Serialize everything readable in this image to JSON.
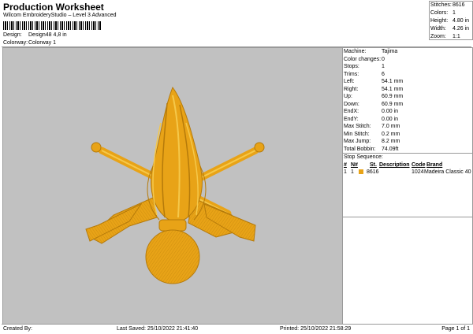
{
  "header": {
    "title": "Production Worksheet",
    "subtitle": "Wilcom EmbroideryStudio – Level 3 Advanced",
    "design_label": "Design:",
    "design_value": "Design48  4,8 in",
    "colorway_label": "Colorway:",
    "colorway_value": "Colorway 1"
  },
  "summary": [
    {
      "label": "Stitches:",
      "value": "8616"
    },
    {
      "label": "Colors:",
      "value": "1"
    },
    {
      "label": "Height:",
      "value": "4.80 in"
    },
    {
      "label": "Width:",
      "value": "4.26 in"
    },
    {
      "label": "Zoom:",
      "value": "1:1"
    }
  ],
  "machine_info": [
    {
      "label": "Machine:",
      "value": "Tajima"
    },
    {
      "label": "Color changes:",
      "value": "0"
    },
    {
      "label": "Stops:",
      "value": "1"
    },
    {
      "label": "Trims:",
      "value": "6"
    },
    {
      "label": "Left:",
      "value": "54.1 mm"
    },
    {
      "label": "Right:",
      "value": "54.1 mm"
    },
    {
      "label": "Up:",
      "value": "60.9 mm"
    },
    {
      "label": "Down:",
      "value": "60.9 mm"
    },
    {
      "label": "EndX:",
      "value": "0.00 in"
    },
    {
      "label": "EndY:",
      "value": "0.00 in"
    },
    {
      "label": "Max Stitch:",
      "value": "7.0 mm"
    },
    {
      "label": "Min Stitch:",
      "value": "0.2 mm"
    },
    {
      "label": "Max Jump:",
      "value": "8.2 mm"
    },
    {
      "label": "Total Bobbin:",
      "value": "74.09ft"
    }
  ],
  "stop_sequence": {
    "title": "Stop Sequence:",
    "headers": {
      "hash": "#",
      "n": "N#",
      "st": "St.",
      "description": "Description",
      "code": "Code",
      "brand": "Brand"
    },
    "rows": [
      {
        "hash": "1",
        "n": "1",
        "swatch_color": "#E8A317",
        "st": "8616",
        "description": "",
        "code": "1024",
        "brand": "Madeira Classic 40"
      }
    ]
  },
  "design_colors": {
    "canvas_bg": "#C1C1C1",
    "thread": "#E8A317",
    "thread_dark": "#B57A0A",
    "thread_light": "#F5C84A"
  },
  "footer": {
    "created_by": "Created By:",
    "last_saved": "Last Saved: 25/10/2022 21:41:40",
    "printed": "Printed: 25/10/2022 21:58:29",
    "page": "Page 1 of 1"
  }
}
